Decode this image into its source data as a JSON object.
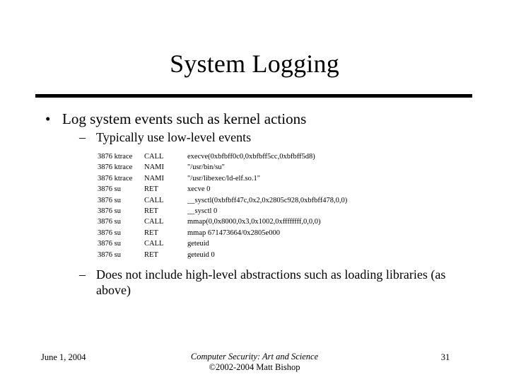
{
  "slide": {
    "title": "System Logging",
    "bullets": [
      {
        "level": 1,
        "marker": "•",
        "text": "Log system events such as kernel actions"
      },
      {
        "level": 2,
        "marker": "–",
        "text": "Typically use low-level events"
      },
      {
        "level": 2,
        "marker": "–",
        "text": "Does not include high-level abstractions such as loading libraries (as above)"
      }
    ],
    "log": {
      "columns": [
        "pid_process",
        "operation",
        "detail"
      ],
      "rows": [
        {
          "pid_process": "3876 ktrace",
          "operation": "CALL",
          "detail": "execve(0xbfbff0c0,0xbfbff5cc,0xbfbff5d8)"
        },
        {
          "pid_process": "3876 ktrace",
          "operation": "NAMI",
          "detail": "\"/usr/bin/su\""
        },
        {
          "pid_process": "3876 ktrace",
          "operation": "NAMI",
          "detail": "\"/usr/libexec/ld-elf.so.1\""
        },
        {
          "pid_process": "3876 su",
          "operation": "RET",
          "detail": "xecve 0"
        },
        {
          "pid_process": "3876 su",
          "operation": "CALL",
          "detail": "__sysctl(0xbfbff47c,0x2,0x2805c928,0xbfbff478,0,0)"
        },
        {
          "pid_process": "3876 su",
          "operation": "RET",
          "detail": "__sysctl 0"
        },
        {
          "pid_process": "3876 su",
          "operation": "CALL",
          "detail": "mmap(0,0x8000,0x3,0x1002,0xffffffff,0,0,0)"
        },
        {
          "pid_process": "3876 su",
          "operation": "RET",
          "detail": "mmap 671473664/0x2805e000"
        },
        {
          "pid_process": "3876 su",
          "operation": "CALL",
          "detail": "geteuid"
        },
        {
          "pid_process": "3876 su",
          "operation": "RET",
          "detail": "geteuid 0"
        }
      ]
    }
  },
  "footer": {
    "date": "June 1, 2004",
    "book_title": "Computer Security: Art and Science",
    "copyright": "©2002-2004 Matt Bishop",
    "page_number": "31"
  },
  "colors": {
    "background": "#ffffff",
    "text": "#000000",
    "rule": "#000000"
  }
}
